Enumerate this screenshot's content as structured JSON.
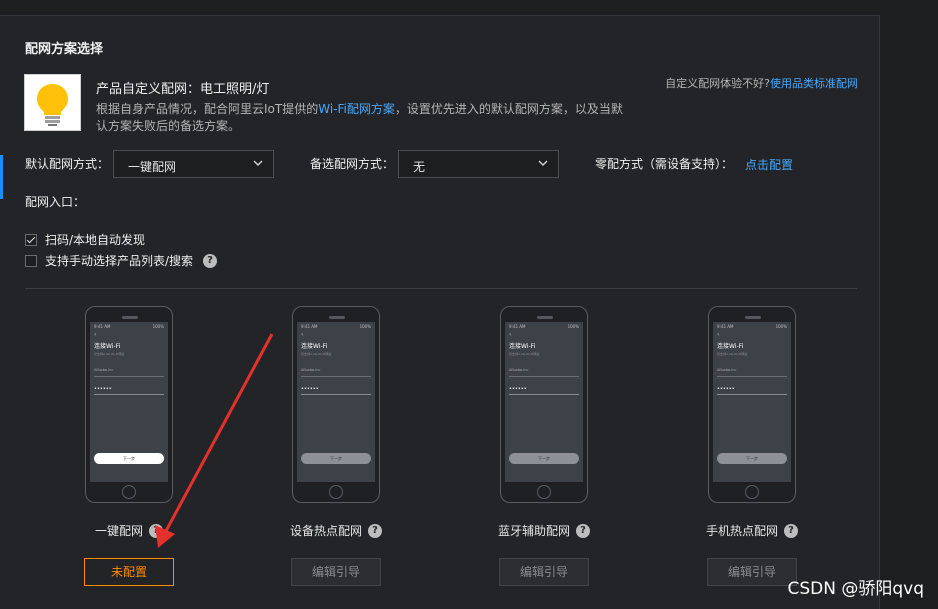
{
  "section_title": "配网方案选择",
  "product": {
    "name": "产品自定义配网：电工照明/灯",
    "desc_prefix": "根据自身产品情况，配合阿里云IoT提供的",
    "desc_link": "Wi-Fi配网方案",
    "desc_suffix": "，设置优先进入的默认配网方案，以及当默认方案失败后的备选方案。"
  },
  "top_hint": {
    "text": "自定义配网体验不好?",
    "link": "使用品类标准配网"
  },
  "default_method": {
    "label": "默认配网方式：",
    "value": "一键配网"
  },
  "backup_method": {
    "label": "备选配网方式：",
    "value": "无"
  },
  "zero_config": {
    "label": "零配方式（需设备支持）：",
    "link": "点击配置"
  },
  "entry_label": "配网入口：",
  "entries": [
    {
      "label": "扫码/本地自动发现",
      "checked": true
    },
    {
      "label": "支持手动选择产品列表/搜索",
      "checked": false
    }
  ],
  "phone_mock": {
    "time": "9:41 AM",
    "battery": "100%",
    "back": "‹",
    "title": "连接Wi-Fi",
    "subtitle": "仅支持2.4G Wi-Fi网络",
    "ssid": "Alibaba-inc",
    "password": "••••••",
    "next": "下一步"
  },
  "cards": [
    {
      "label": "一键配网",
      "button": "未配置",
      "state": "primary"
    },
    {
      "label": "设备热点配网",
      "button": "编辑引导",
      "state": "disabled"
    },
    {
      "label": "蓝牙辅助配网",
      "button": "编辑引导",
      "state": "disabled"
    },
    {
      "label": "手机热点配网",
      "button": "编辑引导",
      "state": "disabled"
    }
  ],
  "help_glyph": "?",
  "annotation_color": "#e5312b",
  "accent_color": "#1a8dff",
  "watermark": "CSDN @骄阳qvq"
}
